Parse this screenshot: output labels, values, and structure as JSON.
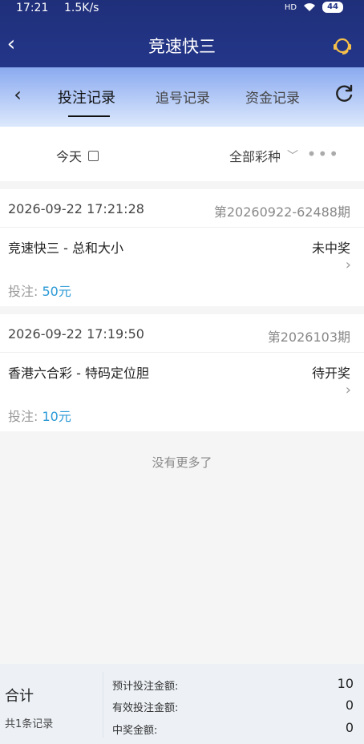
{
  "status_bar": {
    "time": "17:21",
    "speed": "1.5K/s",
    "signal": "HD",
    "battery": "44"
  },
  "titlebar": {
    "title": "竞速快三"
  },
  "tabs": [
    {
      "label": "投注记录",
      "active": true
    },
    {
      "label": "追号记录",
      "active": false
    },
    {
      "label": "资金记录",
      "active": false
    }
  ],
  "filter": {
    "date": "今天",
    "lottery_type": "全部彩种",
    "more": "•••"
  },
  "records": [
    {
      "datetime": "2026-09-22 17:21:28",
      "period": "第20260922-62488期",
      "game": "竞速快三 - 总和大小",
      "result": "未中奖",
      "bet_label": "投注: ",
      "bet_amount": "50元"
    },
    {
      "datetime": "2026-09-22 17:19:50",
      "period": "第2026103期",
      "game": "香港六合彩 - 特码定位胆",
      "result": "待开奖",
      "bet_label": "投注: ",
      "bet_amount": "10元"
    }
  ],
  "no_more": "没有更多了",
  "footer": {
    "total_label": "合计",
    "record_count": "共1条记录",
    "expected_bet_label": "预计投注金额:",
    "expected_bet_value": "10",
    "valid_bet_label": "有效投注金额:",
    "valid_bet_value": "0",
    "win_label": "中奖金额:",
    "win_value": "0"
  },
  "colors": {
    "header_bg": "#243689",
    "accent_amount": "#2c9ad6",
    "tab_gradient_top": "#8aaaf0"
  }
}
